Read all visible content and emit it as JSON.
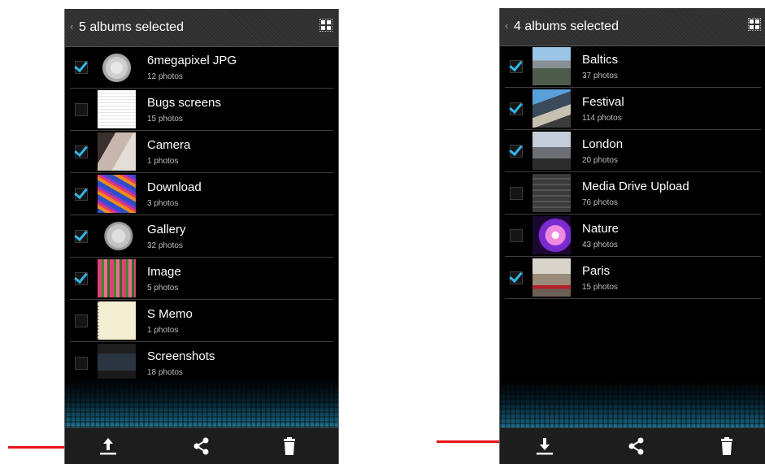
{
  "left_screen": {
    "title": "5 albums selected",
    "back_glyph": "‹",
    "grid_icon": "grid-view-icon",
    "albums": [
      {
        "name": "6megapixel JPG",
        "count": "12 photos",
        "checked": true,
        "thumb": "t-moon"
      },
      {
        "name": "Bugs screens",
        "count": "15 photos",
        "checked": false,
        "thumb": "t-doc"
      },
      {
        "name": "Camera",
        "count": "1 photos",
        "checked": true,
        "thumb": "t-cam"
      },
      {
        "name": "Download",
        "count": "3 photos",
        "checked": true,
        "thumb": "t-dl"
      },
      {
        "name": "Gallery",
        "count": "32 photos",
        "checked": true,
        "thumb": "t-moon2"
      },
      {
        "name": "Image",
        "count": "5 photos",
        "checked": true,
        "thumb": "t-tulip"
      },
      {
        "name": "S Memo",
        "count": "1 photos",
        "checked": false,
        "thumb": "t-memo"
      },
      {
        "name": "Screenshots",
        "count": "18 photos",
        "checked": false,
        "thumb": "t-shots"
      }
    ],
    "bottom_actions": [
      "upload-icon",
      "share-icon",
      "delete-icon"
    ]
  },
  "right_screen": {
    "title": "4 albums selected",
    "back_glyph": "‹",
    "grid_icon": "grid-view-icon",
    "albums": [
      {
        "name": "Baltics",
        "count": "37 photos",
        "checked": true,
        "thumb": "t-baltics"
      },
      {
        "name": "Festival",
        "count": "114 photos",
        "checked": true,
        "thumb": "t-fest"
      },
      {
        "name": "London",
        "count": "20 photos",
        "checked": true,
        "thumb": "t-london"
      },
      {
        "name": "Media Drive Upload",
        "count": "76 photos",
        "checked": false,
        "thumb": "t-media"
      },
      {
        "name": "Nature",
        "count": "43 photos",
        "checked": false,
        "thumb": "t-nature"
      },
      {
        "name": "Paris",
        "count": "15 photos",
        "checked": true,
        "thumb": "t-paris"
      }
    ],
    "bottom_actions": [
      "download-icon",
      "share-icon",
      "delete-icon"
    ]
  },
  "colors": {
    "accent_check": "#33b5e5",
    "annotation_arrow": "#e8141a"
  }
}
